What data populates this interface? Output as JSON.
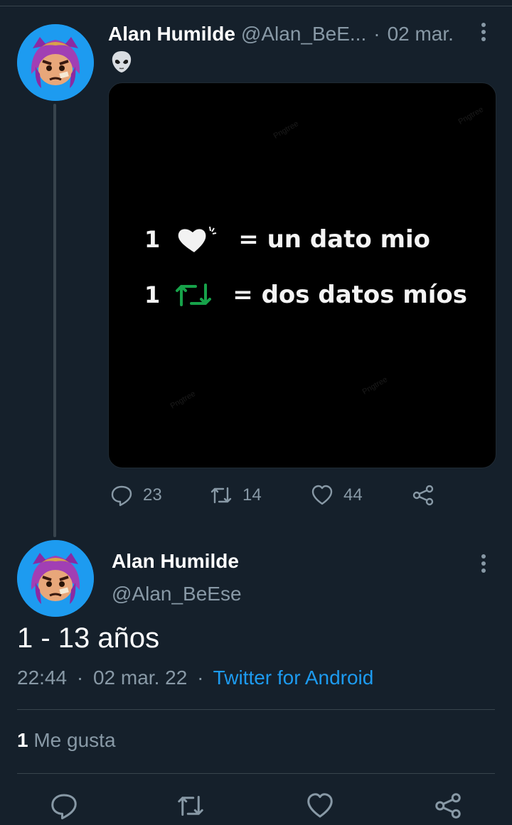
{
  "thread": {
    "tweet1": {
      "name": "Alan Humilde",
      "handle": "@Alan_BeE...",
      "separator": "·",
      "date": "02 mar.",
      "emoji_icon": "alien-emoji-icon",
      "media": {
        "line1_count": "1",
        "line1_text": "= un dato mio",
        "line2_count": "1",
        "line2_text": "= dos datos míos",
        "heart_icon": "white-heart-icon",
        "retweet_icon": "green-retweet-icon",
        "watermark": "Pngtree"
      },
      "actions": {
        "replies": "23",
        "retweets": "14",
        "likes": "44"
      }
    },
    "tweet2": {
      "name": "Alan Humilde",
      "handle": "@Alan_BeEse",
      "text": "1 - 13 años",
      "time": "22:44",
      "date": "02 mar. 22",
      "separator": "·",
      "source": "Twitter for Android",
      "likes_count": "1",
      "likes_label": "Me gusta"
    }
  },
  "colors": {
    "background": "#15202b",
    "secondary_text": "#8899a6",
    "accent": "#1d9bf0",
    "divider": "#38444d",
    "retweet_green": "#17a24a"
  }
}
